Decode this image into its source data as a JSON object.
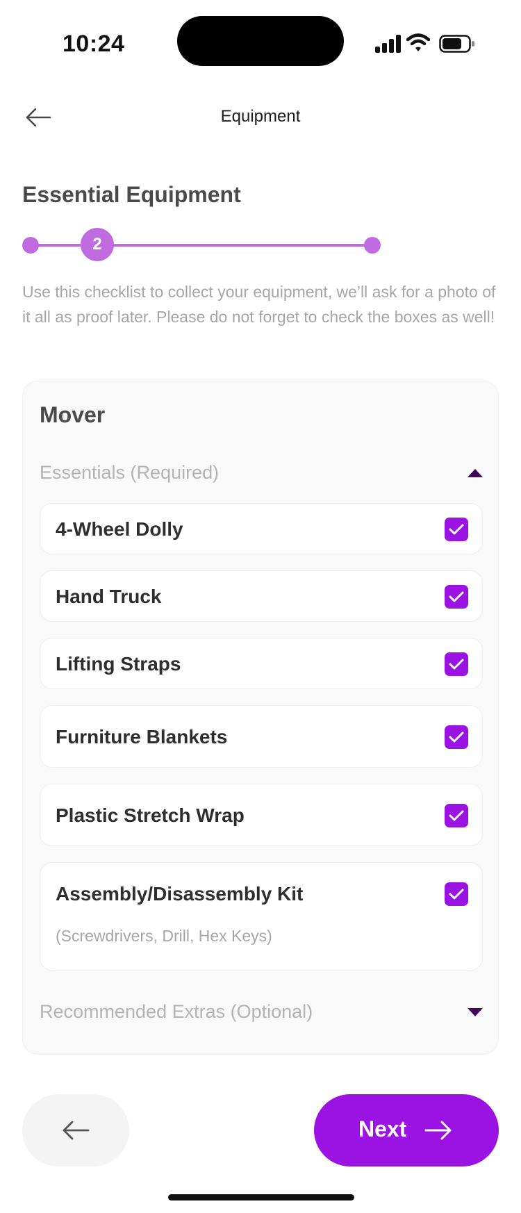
{
  "status_bar": {
    "time": "10:24"
  },
  "header": {
    "title": "Equipment"
  },
  "page": {
    "title": "Essential Equipment",
    "description": "Use this checklist to collect your equipment, we’ll ask for a photo of it all as proof later. Please do not forget to check the boxes as well!"
  },
  "stepper": {
    "current_step": "2"
  },
  "card": {
    "title": "Mover",
    "essentials": {
      "label": "Essentials (Required)",
      "expanded": true,
      "items": [
        {
          "name": "4-Wheel Dolly",
          "checked": true
        },
        {
          "name": "Hand Truck",
          "checked": true
        },
        {
          "name": "Lifting Straps",
          "checked": true
        },
        {
          "name": "Furniture Blankets",
          "checked": true
        },
        {
          "name": "Plastic Stretch Wrap",
          "checked": true
        },
        {
          "name": "Assembly/Disassembly Kit",
          "note": "(Screwdrivers, Drill, Hex Keys)",
          "checked": true
        }
      ]
    },
    "extras": {
      "label": "Recommended Extras (Optional)",
      "expanded": false
    }
  },
  "footer": {
    "next_label": "Next"
  },
  "colors": {
    "accent": "#9b13e3",
    "stepper": "#c06be0",
    "caret": "#3d0a5c",
    "muted_text": "#a6a6a6"
  }
}
